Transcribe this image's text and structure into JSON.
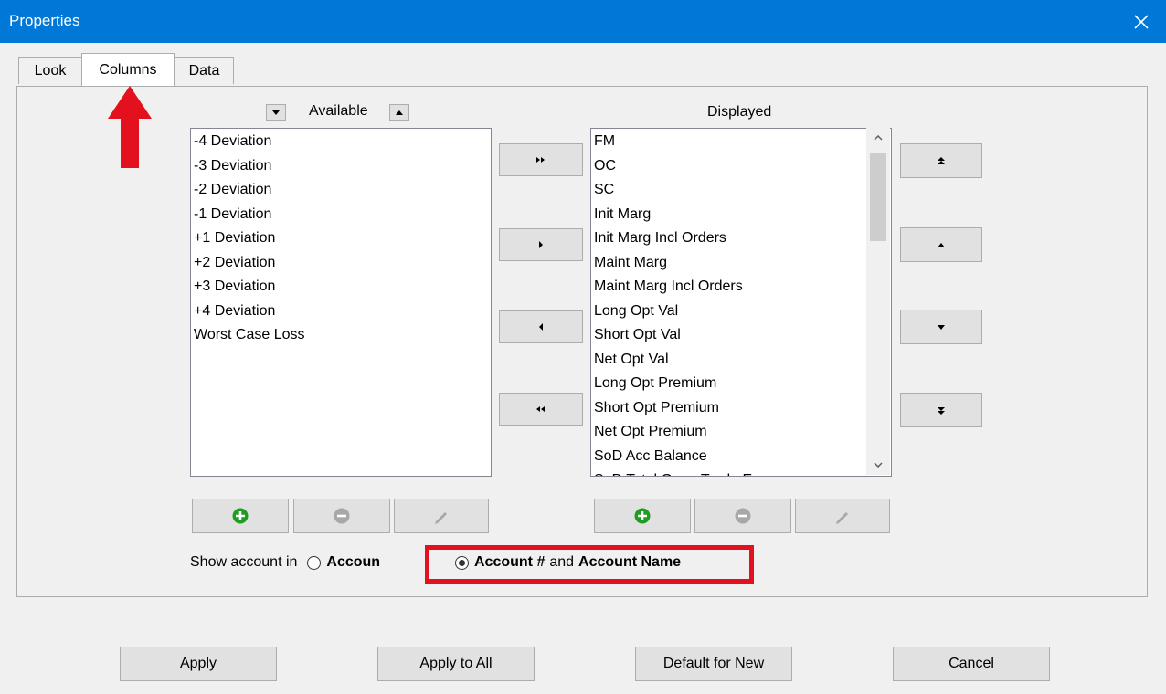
{
  "window": {
    "title": "Properties"
  },
  "tabs": [
    {
      "label": "Look"
    },
    {
      "label": "Columns"
    },
    {
      "label": "Data"
    }
  ],
  "available": {
    "label": "Available",
    "items": [
      "-4 Deviation",
      "-3 Deviation",
      "-2 Deviation",
      "-1 Deviation",
      "+1 Deviation",
      "+2 Deviation",
      "+3 Deviation",
      "+4 Deviation",
      "Worst Case Loss"
    ]
  },
  "displayed": {
    "label": "Displayed",
    "items": [
      "FM",
      "OC",
      "SC",
      "Init Marg",
      "Init Marg Incl Orders",
      "Maint Marg",
      "Maint Marg Incl Orders",
      "Long Opt Val",
      "Short Opt Val",
      "Net Opt Val",
      "Long Opt Premium",
      "Short Opt Premium",
      "Net Opt Premium",
      "SoD Acc Balance",
      "SoD Total Open Trade Eq"
    ]
  },
  "show_account": {
    "label": "Show account in",
    "option1": "Accoun",
    "option2_bold1": "Account #",
    "option2_and": "and",
    "option2_bold2": "Account Name"
  },
  "buttons": {
    "apply": "Apply",
    "apply_all": "Apply to All",
    "default_new": "Default for New",
    "cancel": "Cancel"
  },
  "colors": {
    "titlebar": "#0078d7",
    "highlight": "#e3111d",
    "add_icon": "#1e9e1e"
  }
}
